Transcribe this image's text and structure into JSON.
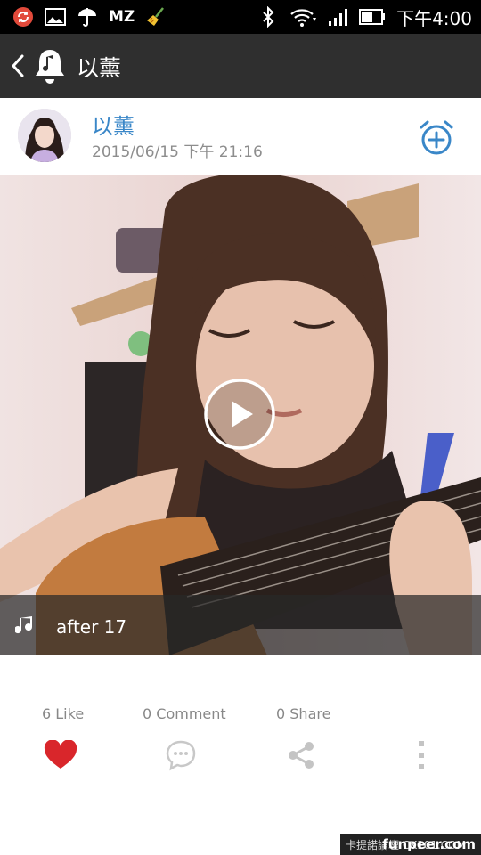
{
  "status_bar": {
    "time": "下午4:00",
    "mz_label": "MZ",
    "icons": [
      "sync-icon",
      "image-icon",
      "umbrella-icon",
      "mz-icon",
      "broom-icon",
      "bluetooth-icon",
      "wifi-icon",
      "signal-icon",
      "battery-icon"
    ]
  },
  "toolbar": {
    "title": "以薰",
    "back_icon": "chevron-left-icon",
    "channel_icon": "bell-music-icon"
  },
  "post": {
    "user_name": "以薰",
    "date": "2015/06/15 下午 21:16",
    "follow_icon": "alarm-add-icon"
  },
  "video": {
    "song_title": "after 17",
    "play_icon": "play-icon",
    "music_icon": "music-note-icon"
  },
  "stats": {
    "likes": "6 Like",
    "comments": "0 Comment",
    "shares": "0 Share"
  },
  "actions": {
    "like_icon": "heart-icon",
    "comment_icon": "comment-icon",
    "share_icon": "share-icon",
    "more_icon": "more-vertical-icon"
  },
  "colors": {
    "accent_blue": "#3a87c8",
    "like_red": "#d9262b",
    "toolbar": "#2f2f2f"
  },
  "watermark": {
    "left_text": "卡提諾論壇 CK101.COM",
    "right_text": "funpeer.com"
  }
}
